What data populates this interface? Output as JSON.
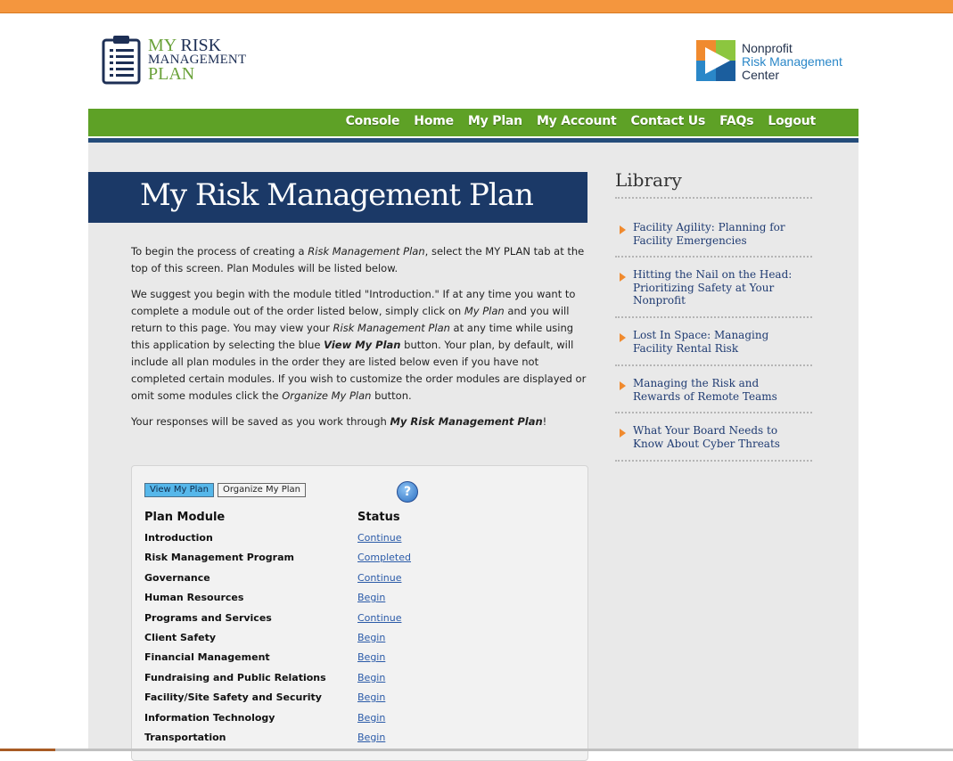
{
  "header": {
    "logo_left": {
      "line1_a": "MY",
      "line1_b": "RISK",
      "line2": "MANAGEMENT",
      "line3": "PLAN"
    },
    "logo_right": {
      "line1": "Nonprofit",
      "line2": "Risk Management",
      "line3": "Center"
    }
  },
  "nav": [
    "Console",
    "Home",
    "My Plan",
    "My Account",
    "Contact Us",
    "FAQs",
    "Logout"
  ],
  "colors": {
    "top_bar": "#f4963e",
    "nav_green": "#5ea126",
    "banner_navy": "#1b3967",
    "link_blue": "#2a5aa8",
    "view_button": "#56b7ea"
  },
  "main": {
    "title": "My Risk Management Plan",
    "p1": {
      "a": "To begin the process of creating a ",
      "b": "Risk Management Plan",
      "c": ", select the MY PLAN tab at the top of this screen. Plan Modules will be listed below."
    },
    "p2": {
      "a": "We suggest you begin with the module titled \"Introduction.\" If at any time you want to complete a module out of the order listed below, simply click on ",
      "b": "My Plan",
      "c": " and you will return to this page. You may view your ",
      "d": "Risk Management Plan",
      "e": " at any time while using this application by selecting the blue ",
      "f": "View My Plan",
      "g": " button. Your plan, by default, will include all plan modules in the order they are listed below even if you have not completed certain modules. If you wish to customize the order modules are displayed or omit some modules click the ",
      "h": "Organize My Plan",
      "i": " button."
    },
    "p3": {
      "a": "Your responses will be saved as you work through ",
      "b": "My Risk Management Plan",
      "c": "!"
    }
  },
  "plan": {
    "view_label": "View My Plan",
    "organize_label": "Organize My Plan",
    "help_icon": "?",
    "col_module": "Plan Module",
    "col_status": "Status",
    "rows": [
      {
        "module": "Introduction",
        "status": "Continue"
      },
      {
        "module": "Risk Management Program",
        "status": "Completed"
      },
      {
        "module": "Governance",
        "status": "Continue"
      },
      {
        "module": "Human Resources",
        "status": "Begin"
      },
      {
        "module": "Programs and Services",
        "status": "Continue"
      },
      {
        "module": "Client Safety",
        "status": "Begin"
      },
      {
        "module": "Financial Management",
        "status": "Begin"
      },
      {
        "module": "Fundraising and Public Relations",
        "status": "Begin"
      },
      {
        "module": "Facility/Site Safety and Security",
        "status": "Begin"
      },
      {
        "module": "Information Technology",
        "status": "Begin"
      },
      {
        "module": "Transportation",
        "status": "Begin"
      }
    ]
  },
  "library": {
    "title": "Library",
    "items": [
      "Facility Agility: Planning for Facility Emergencies",
      "Hitting the Nail on the Head: Prioritizing Safety at Your Nonprofit",
      "Lost In Space: Managing Facility Rental Risk",
      "Managing the Risk and Rewards of Remote Teams",
      "What Your Board Needs to Know About Cyber Threats"
    ]
  }
}
